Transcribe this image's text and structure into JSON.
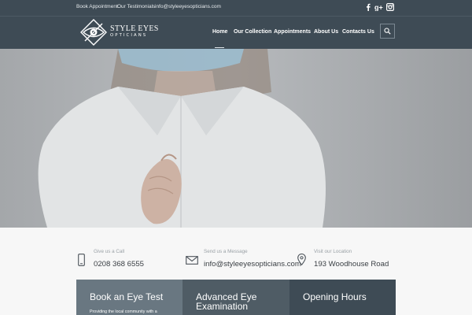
{
  "topbar": {
    "links": [
      "Book Appointment",
      "Our Testimonials",
      "info@styleeyesopticians.com"
    ],
    "social_icons": [
      "facebook-icon",
      "google-plus-icon",
      "instagram-icon"
    ]
  },
  "logo": {
    "line1": "STYLE EYES",
    "line2": "OPTICIANS"
  },
  "nav": {
    "items": [
      "Home",
      "Our Collection",
      "Appointments",
      "About Us",
      "Contacts Us"
    ],
    "active": "Home",
    "search_icon": "search-icon"
  },
  "hero": {
    "image_alt": "Person wearing a surgical mask with clasped hands, wearing a white shirt"
  },
  "contacts": [
    {
      "label": "Give us a Call",
      "value": "0208 368 6555",
      "icon": "phone-icon"
    },
    {
      "label": "Send us a Message",
      "value": "info@styleeyesopticians.com",
      "icon": "envelope-icon"
    },
    {
      "label": "Visit our Location",
      "value": "193 Woodhouse Road",
      "icon": "location-pin-icon"
    }
  ],
  "boxes": [
    {
      "title": "Book an Eye Test",
      "text": "Providing the local community with a",
      "color": "#697781"
    },
    {
      "title_line1": "Advanced Eye",
      "title_line2": "Examination",
      "color": "#4f5c65"
    },
    {
      "title": "Opening Hours",
      "color": "#3e4b55"
    }
  ],
  "colors": {
    "header_bg": "#3e4b55",
    "strip_bg": "#f7f7f7"
  }
}
